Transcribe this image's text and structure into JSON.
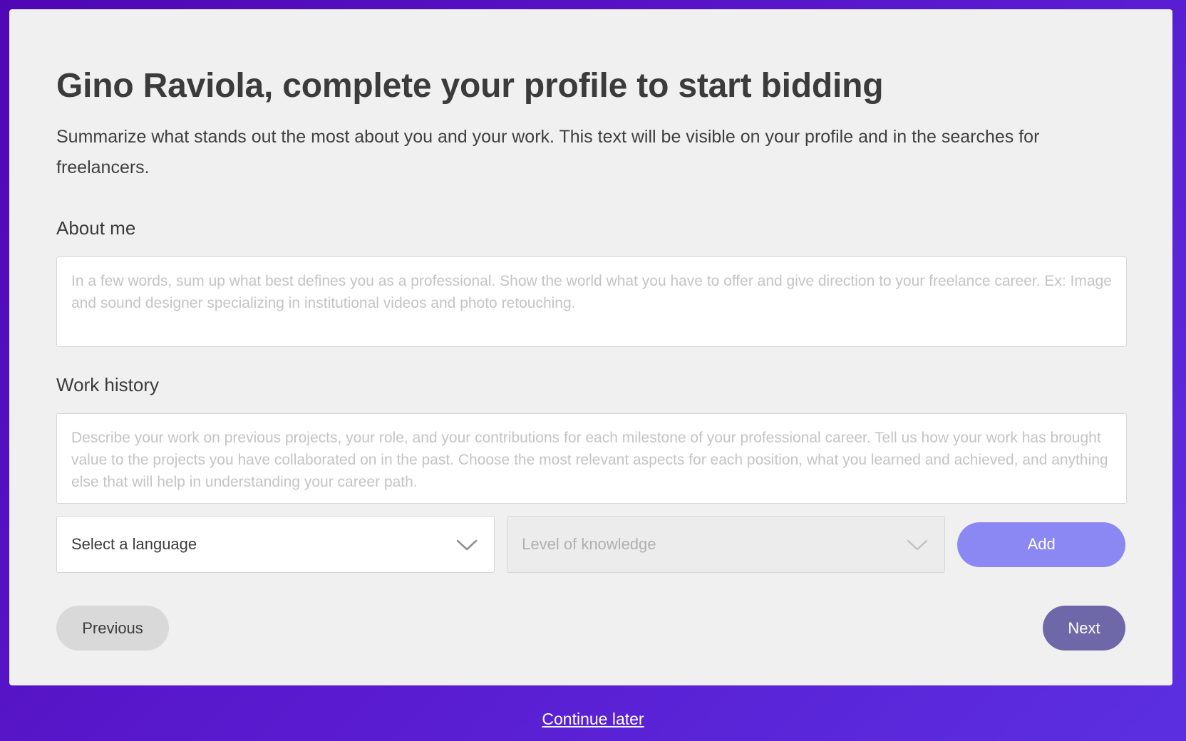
{
  "page": {
    "title": "Gino Raviola, complete your profile to start bidding",
    "subtitle": "Summarize what stands out the most about you and your work. This text will be visible on your profile and in the searches for freelancers."
  },
  "about_me": {
    "label": "About me",
    "value": "",
    "placeholder": "In a few words, sum up what best defines you as a professional. Show the world what you have to offer and give direction to your freelance career. Ex: Image and sound designer specializing in institutional videos and photo retouching."
  },
  "work_history": {
    "label": "Work history",
    "value": "",
    "placeholder": "Describe your work on previous projects, your role, and your contributions for each milestone of your professional career. Tell us how your work has brought value to the projects you have collaborated on in the past. Choose the most relevant aspects for each position, what you learned and achieved, and anything else that will help in understanding your career path."
  },
  "language": {
    "select_label": "Select a language",
    "level_label": "Level of knowledge",
    "add_label": "Add",
    "chevron_icon": "chevron-down-icon"
  },
  "navigation": {
    "previous_label": "Previous",
    "next_label": "Next",
    "continue_later_label": "Continue later"
  },
  "colors": {
    "background_gradient_start": "#4f07b3",
    "background_gradient_end": "#5b2fe0",
    "card": "#f0f0f0",
    "add_button": "#8b87f3",
    "next_button": "#6e68a8",
    "previous_button": "#d9d9d9"
  }
}
